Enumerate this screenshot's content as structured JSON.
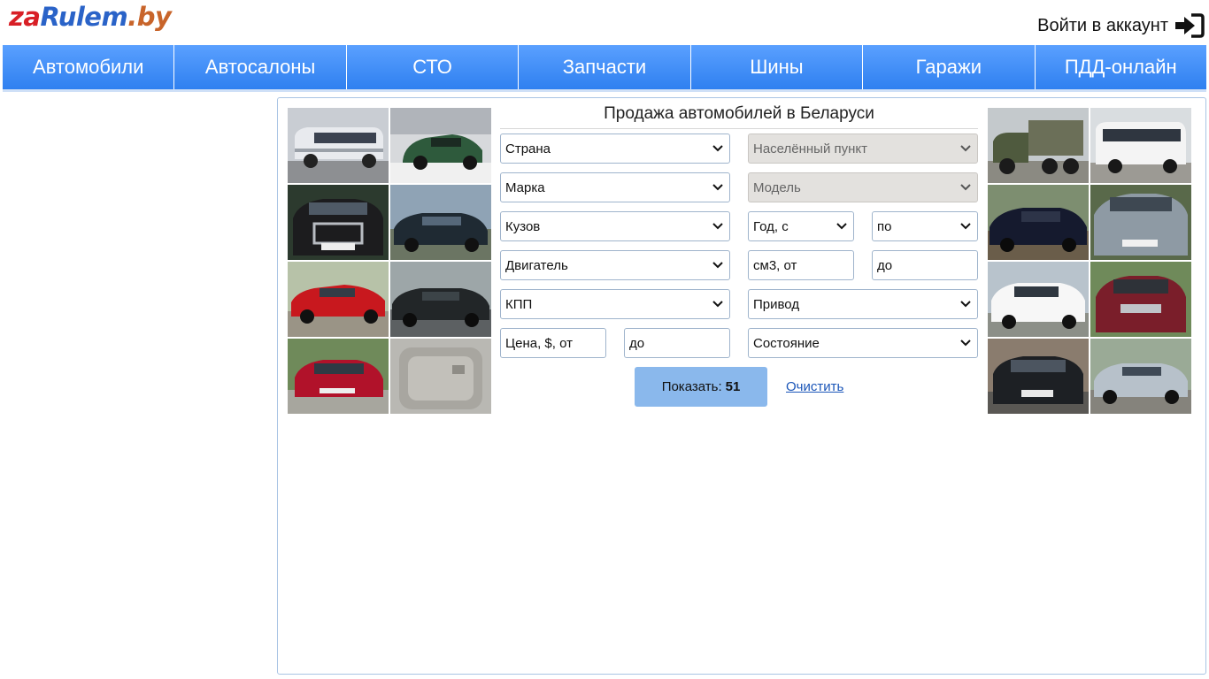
{
  "header": {
    "logo": {
      "part1": "za",
      "part2": "Rulem",
      "part3": ".by"
    },
    "account_label": "Войти в аккаунт",
    "account_icon": "sign-in-icon"
  },
  "nav": {
    "items": [
      "Автомобили",
      "Автосалоны",
      "СТО",
      "Запчасти",
      "Шины",
      "Гаражи",
      "ПДД-онлайн"
    ]
  },
  "search": {
    "title": "Продажа автомобилей в Беларуси",
    "fields": {
      "country": "Страна",
      "locality": "Населённый пункт",
      "brand": "Марка",
      "model": "Модель",
      "body": "Кузов",
      "year_from": "Год, с",
      "year_to": "по",
      "engine": "Двигатель",
      "volume_from": "см3, от",
      "volume_to": "до",
      "gearbox": "КПП",
      "drive": "Привод",
      "price_from": "Цена, $, от",
      "price_to": "до",
      "condition": "Состояние"
    },
    "show_label": "Показать:",
    "show_count": "51",
    "clear_label": "Очистить"
  },
  "colors": {
    "nav_top": "#5aa0ff",
    "nav_bottom": "#2f80f0",
    "button": "#8ab8ec",
    "link": "#1a55b8",
    "panel_border": "#a9c4e4"
  }
}
